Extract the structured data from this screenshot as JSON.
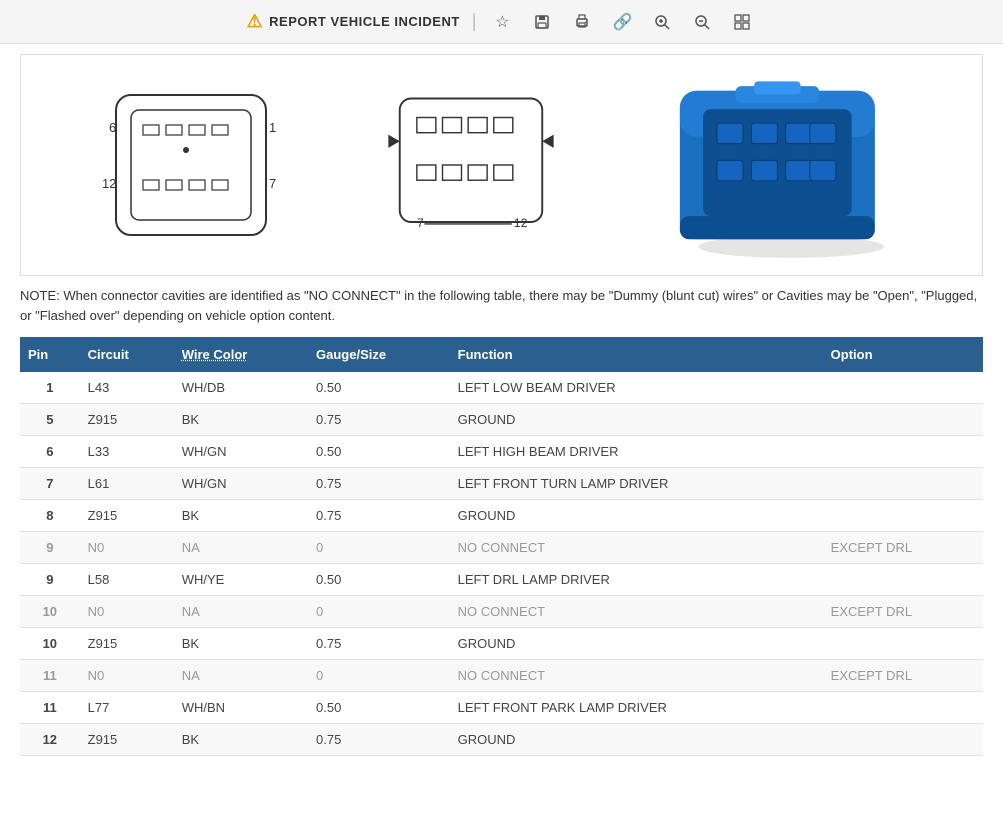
{
  "toolbar": {
    "incident_label": "REPORT VEHICLE INCIDENT",
    "icons": [
      {
        "name": "star-icon",
        "symbol": "☆"
      },
      {
        "name": "save-icon",
        "symbol": "💾"
      },
      {
        "name": "print-icon",
        "symbol": "🖨"
      },
      {
        "name": "link-icon",
        "symbol": "🔗"
      },
      {
        "name": "zoom-in-icon",
        "symbol": "🔍"
      },
      {
        "name": "zoom-out-icon",
        "symbol": "🔍"
      },
      {
        "name": "more-icon",
        "symbol": "⊞"
      }
    ]
  },
  "note": {
    "text": "NOTE: When connector cavities are identified as \"NO CONNECT\" in the following table, there may be \"Dummy (blunt cut) wires\" or Cavities may be \"Open\", \"Plugged, or \"Flashed over\" depending on vehicle option content."
  },
  "table": {
    "headers": [
      "Pin",
      "Circuit",
      "Wire Color",
      "Gauge/Size",
      "Function",
      "Option"
    ],
    "rows": [
      {
        "pin": "1",
        "circuit": "L43",
        "wire_color": "WH/DB",
        "gauge": "0.50",
        "function": "LEFT LOW BEAM DRIVER",
        "option": "",
        "no_connect": false
      },
      {
        "pin": "5",
        "circuit": "Z915",
        "wire_color": "BK",
        "gauge": "0.75",
        "function": "GROUND",
        "option": "",
        "no_connect": false
      },
      {
        "pin": "6",
        "circuit": "L33",
        "wire_color": "WH/GN",
        "gauge": "0.50",
        "function": "LEFT HIGH BEAM DRIVER",
        "option": "",
        "no_connect": false
      },
      {
        "pin": "7",
        "circuit": "L61",
        "wire_color": "WH/GN",
        "gauge": "0.75",
        "function": "LEFT FRONT TURN LAMP DRIVER",
        "option": "",
        "no_connect": false
      },
      {
        "pin": "8",
        "circuit": "Z915",
        "wire_color": "BK",
        "gauge": "0.75",
        "function": "GROUND",
        "option": "",
        "no_connect": false
      },
      {
        "pin": "9",
        "circuit": "N0",
        "wire_color": "NA",
        "gauge": "0",
        "function": "NO CONNECT",
        "option": "EXCEPT DRL",
        "no_connect": true
      },
      {
        "pin": "9",
        "circuit": "L58",
        "wire_color": "WH/YE",
        "gauge": "0.50",
        "function": "LEFT DRL LAMP DRIVER",
        "option": "",
        "no_connect": false
      },
      {
        "pin": "10",
        "circuit": "N0",
        "wire_color": "NA",
        "gauge": "0",
        "function": "NO CONNECT",
        "option": "EXCEPT DRL",
        "no_connect": true
      },
      {
        "pin": "10",
        "circuit": "Z915",
        "wire_color": "BK",
        "gauge": "0.75",
        "function": "GROUND",
        "option": "",
        "no_connect": false
      },
      {
        "pin": "11",
        "circuit": "N0",
        "wire_color": "NA",
        "gauge": "0",
        "function": "NO CONNECT",
        "option": "EXCEPT DRL",
        "no_connect": true
      },
      {
        "pin": "11",
        "circuit": "L77",
        "wire_color": "WH/BN",
        "gauge": "0.50",
        "function": "LEFT FRONT PARK LAMP DRIVER",
        "option": "",
        "no_connect": false
      },
      {
        "pin": "12",
        "circuit": "Z915",
        "wire_color": "BK",
        "gauge": "0.75",
        "function": "GROUND",
        "option": "",
        "no_connect": false
      }
    ],
    "diagram_labels": {
      "left_label_6": "6",
      "left_label_1": "1",
      "left_label_12": "12",
      "left_label_7": "7",
      "mid_label_7": "7",
      "mid_label_12": "12"
    }
  },
  "colors": {
    "header_bg": "#2a5f8f",
    "header_text": "#ffffff",
    "accent_blue": "#1a6fbf"
  }
}
